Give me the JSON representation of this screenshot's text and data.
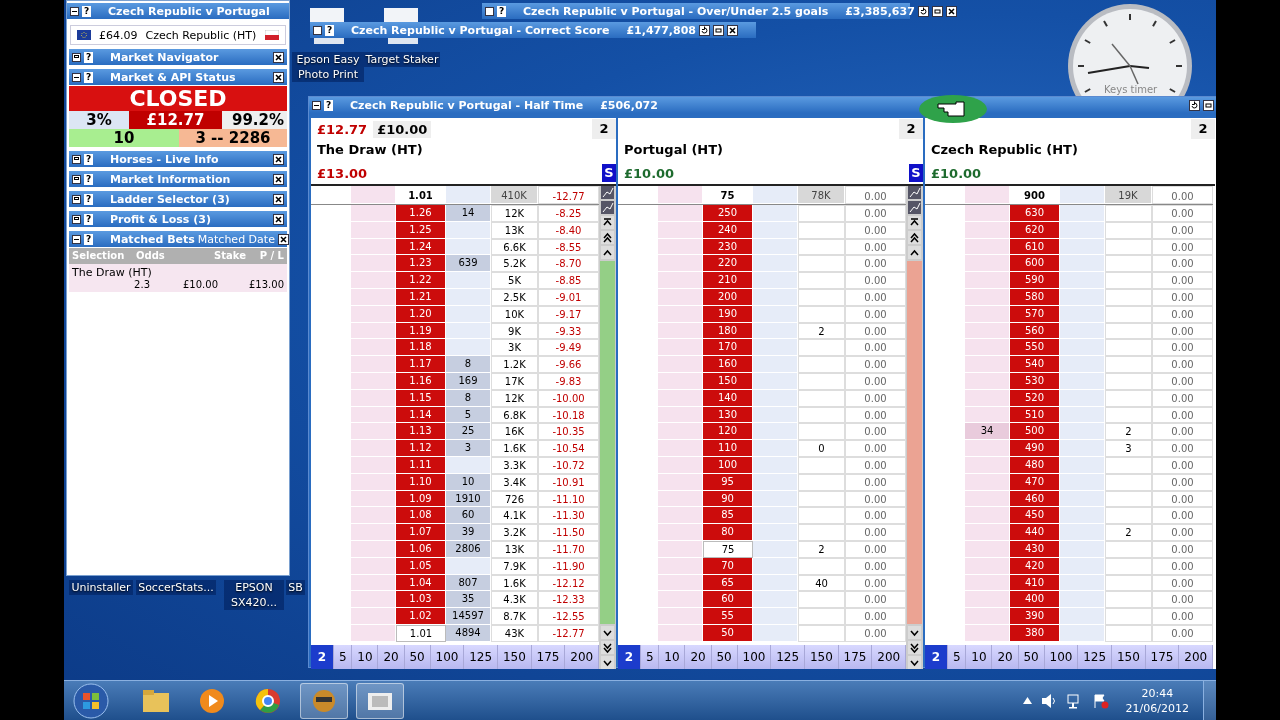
{
  "desktop_icons": [
    {
      "label": "Epson Easy Photo Print"
    },
    {
      "label": "Target Staker"
    },
    {
      "label": "Uninstaller"
    },
    {
      "label": "SoccerStats..."
    },
    {
      "label": "EPSON SX420..."
    },
    {
      "label": "SB"
    }
  ],
  "clock_label": "Keys timer",
  "background_windows": [
    {
      "help": "?",
      "title": "Czech Republic v Portugal - Over/Under 2.5 goals",
      "amount": "£3,385,637"
    },
    {
      "help": "?",
      "title": "Czech Republic v Portugal - Correct Score",
      "amount": "£1,477,808"
    }
  ],
  "side_panel": {
    "help": "?",
    "title": "Czech Republic v Portugal",
    "balance": "£64.09",
    "selection": "Czech Republic (HT)",
    "sections": [
      {
        "help": "?",
        "title": "Market Navigator",
        "expanded": false
      },
      {
        "help": "?",
        "title": "Market & API Status",
        "expanded": true,
        "kind": "status",
        "status": "CLOSED",
        "left_pct": "3%",
        "exposure": "£12.77",
        "right_pct": "99.2%",
        "left_count": "10",
        "right_count": "3 -- 2286"
      },
      {
        "help": "?",
        "title": "Horses - Live Info",
        "expanded": false
      },
      {
        "help": "?",
        "title": "Market Information",
        "expanded": false
      },
      {
        "help": "?",
        "title": "Ladder Selector (3)",
        "expanded": false
      },
      {
        "help": "?",
        "title": "Profit & Loss (3)",
        "expanded": false
      },
      {
        "help": "?",
        "title": "Matched Bets",
        "subtitle": "Matched Date",
        "expanded": true,
        "kind": "table",
        "columns": [
          "Selection",
          "Odds",
          "Stake",
          "P / L"
        ],
        "rows": [
          {
            "selection": "The Draw (HT)",
            "odds": "2.3",
            "stake": "£10.00",
            "pl": "£13.00"
          }
        ]
      }
    ]
  },
  "main_window": {
    "help": "?",
    "title": "Czech Republic v Portugal - Half Time",
    "amount": "£506,072",
    "ladders": [
      {
        "exposure": "£12.77",
        "stake": "£10.00",
        "tick": "2",
        "name": "The Draw (HT)",
        "pl": "£13.00",
        "color": "#c00000",
        "s_button": "S",
        "kind": "back",
        "grid_loss": true,
        "top": {
          "odds": "1.01",
          "vol": "410K",
          "pl": "-12.77"
        },
        "rows": [
          {
            "odds": "1.26",
            "lay": "14",
            "vol": "12K",
            "pl": "-8.25",
            "ltp": false
          },
          {
            "odds": "1.25",
            "vol": "13K",
            "pl": "-8.40",
            "ltp": false
          },
          {
            "odds": "1.24",
            "vol": "6.6K",
            "pl": "-8.55",
            "ltp": false
          },
          {
            "odds": "1.23",
            "lay": "639",
            "vol": "5.2K",
            "pl": "-8.70",
            "ltp": false
          },
          {
            "odds": "1.22",
            "vol": "5K",
            "pl": "-8.85",
            "ltp": false
          },
          {
            "odds": "1.21",
            "vol": "2.5K",
            "pl": "-9.01",
            "ltp": false
          },
          {
            "odds": "1.20",
            "vol": "10K",
            "pl": "-9.17",
            "ltp": false
          },
          {
            "odds": "1.19",
            "vol": "9K",
            "pl": "-9.33",
            "ltp": false
          },
          {
            "odds": "1.18",
            "vol": "3K",
            "pl": "-9.49",
            "ltp": false
          },
          {
            "odds": "1.17",
            "lay": "8",
            "vol": "1.2K",
            "pl": "-9.66",
            "ltp": false
          },
          {
            "odds": "1.16",
            "lay": "169",
            "vol": "17K",
            "pl": "-9.83",
            "ltp": false
          },
          {
            "odds": "1.15",
            "lay": "8",
            "vol": "12K",
            "pl": "-10.00",
            "ltp": false
          },
          {
            "odds": "1.14",
            "lay": "5",
            "vol": "6.8K",
            "pl": "-10.18",
            "ltp": false
          },
          {
            "odds": "1.13",
            "lay": "25",
            "vol": "16K",
            "pl": "-10.35",
            "ltp": false
          },
          {
            "odds": "1.12",
            "lay": "3",
            "vol": "1.6K",
            "pl": "-10.54",
            "ltp": false
          },
          {
            "odds": "1.11",
            "vol": "3.3K",
            "pl": "-10.72",
            "ltp": false
          },
          {
            "odds": "1.10",
            "lay": "10",
            "vol": "3.4K",
            "pl": "-10.91",
            "ltp": false
          },
          {
            "odds": "1.09",
            "lay": "1910",
            "vol": "726",
            "pl": "-11.10",
            "ltp": false
          },
          {
            "odds": "1.08",
            "lay": "60",
            "vol": "4.1K",
            "pl": "-11.30",
            "ltp": false
          },
          {
            "odds": "1.07",
            "lay": "39",
            "vol": "3.2K",
            "pl": "-11.50",
            "ltp": false
          },
          {
            "odds": "1.06",
            "lay": "2806",
            "vol": "13K",
            "pl": "-11.70",
            "ltp": false
          },
          {
            "odds": "1.05",
            "vol": "7.9K",
            "pl": "-11.90",
            "ltp": false
          },
          {
            "odds": "1.04",
            "lay": "807",
            "vol": "1.6K",
            "pl": "-12.12",
            "ltp": false
          },
          {
            "odds": "1.03",
            "lay": "35",
            "vol": "4.3K",
            "pl": "-12.33",
            "ltp": false
          },
          {
            "odds": "1.02",
            "lay": "14597",
            "vol": "8.7K",
            "pl": "-12.55",
            "ltp": false
          },
          {
            "odds": "1.01",
            "lay": "4894",
            "vol": "43K",
            "pl": "-12.77",
            "ltp": true
          }
        ],
        "stakes": [
          {
            "label": "2",
            "selected": true
          },
          {
            "label": "5",
            "selected": false
          },
          {
            "label": "10",
            "selected": false
          },
          {
            "label": "20",
            "selected": false
          },
          {
            "label": "50",
            "selected": false
          },
          {
            "label": "100",
            "selected": false
          },
          {
            "label": "125",
            "selected": false
          },
          {
            "label": "150",
            "selected": false
          },
          {
            "label": "175",
            "selected": false
          },
          {
            "label": "200",
            "selected": false
          }
        ]
      },
      {
        "tick": "2",
        "name": "Portugal (HT)",
        "pl": "£10.00",
        "color": "#1e6b2e",
        "s_button": "S",
        "kind": "lay",
        "grid_loss": false,
        "top": {
          "odds": "75",
          "vol": "78K",
          "pl": "0.00"
        },
        "rows": [
          {
            "odds": "250",
            "pl": "0.00",
            "ltp": false
          },
          {
            "odds": "240",
            "pl": "0.00",
            "ltp": false
          },
          {
            "odds": "230",
            "pl": "0.00",
            "ltp": false
          },
          {
            "odds": "220",
            "pl": "0.00",
            "ltp": false
          },
          {
            "odds": "210",
            "pl": "0.00",
            "ltp": false
          },
          {
            "odds": "200",
            "pl": "0.00",
            "ltp": false
          },
          {
            "odds": "190",
            "pl": "0.00",
            "ltp": false
          },
          {
            "odds": "180",
            "vol": "2",
            "pl": "0.00",
            "ltp": false
          },
          {
            "odds": "170",
            "pl": "0.00",
            "ltp": false
          },
          {
            "odds": "160",
            "pl": "0.00",
            "ltp": false
          },
          {
            "odds": "150",
            "pl": "0.00",
            "ltp": false
          },
          {
            "odds": "140",
            "pl": "0.00",
            "ltp": false
          },
          {
            "odds": "130",
            "pl": "0.00",
            "ltp": false
          },
          {
            "odds": "120",
            "pl": "0.00",
            "ltp": false
          },
          {
            "odds": "110",
            "vol": "0",
            "pl": "0.00",
            "ltp": false
          },
          {
            "odds": "100",
            "pl": "0.00",
            "ltp": false
          },
          {
            "odds": "95",
            "pl": "0.00",
            "ltp": false
          },
          {
            "odds": "90",
            "pl": "0.00",
            "ltp": false
          },
          {
            "odds": "85",
            "pl": "0.00",
            "ltp": false
          },
          {
            "odds": "80",
            "pl": "0.00",
            "ltp": false
          },
          {
            "odds": "75",
            "vol": "2",
            "pl": "0.00",
            "ltp": true
          },
          {
            "odds": "70",
            "pl": "0.00",
            "ltp": false
          },
          {
            "odds": "65",
            "vol": "40",
            "pl": "0.00",
            "ltp": false
          },
          {
            "odds": "60",
            "pl": "0.00",
            "ltp": false
          },
          {
            "odds": "55",
            "pl": "0.00",
            "ltp": false
          },
          {
            "odds": "50",
            "pl": "0.00",
            "ltp": false
          }
        ],
        "stakes": [
          {
            "label": "2",
            "selected": true
          },
          {
            "label": "5",
            "selected": false
          },
          {
            "label": "10",
            "selected": false
          },
          {
            "label": "20",
            "selected": false
          },
          {
            "label": "50",
            "selected": false
          },
          {
            "label": "100",
            "selected": false
          },
          {
            "label": "125",
            "selected": false
          },
          {
            "label": "150",
            "selected": false
          },
          {
            "label": "175",
            "selected": false
          },
          {
            "label": "200",
            "selected": false
          }
        ]
      },
      {
        "tick": "2",
        "name": "Czech Republic (HT)",
        "pl": "£10.00",
        "color": "#1e6b2e",
        "kind": "plain",
        "grid_loss": false,
        "top": {
          "odds": "900",
          "vol": "19K",
          "pl": "0.00"
        },
        "rows": [
          {
            "odds": "630",
            "pl": "0.00",
            "ltp": false
          },
          {
            "odds": "620",
            "pl": "0.00",
            "ltp": false
          },
          {
            "odds": "610",
            "pl": "0.00",
            "ltp": false
          },
          {
            "odds": "600",
            "pl": "0.00",
            "ltp": false
          },
          {
            "odds": "590",
            "pl": "0.00",
            "ltp": false
          },
          {
            "odds": "580",
            "pl": "0.00",
            "ltp": false
          },
          {
            "odds": "570",
            "pl": "0.00",
            "ltp": false
          },
          {
            "odds": "560",
            "pl": "0.00",
            "ltp": false
          },
          {
            "odds": "550",
            "pl": "0.00",
            "ltp": false
          },
          {
            "odds": "540",
            "pl": "0.00",
            "ltp": false
          },
          {
            "odds": "530",
            "pl": "0.00",
            "ltp": false
          },
          {
            "odds": "520",
            "pl": "0.00",
            "ltp": false
          },
          {
            "odds": "510",
            "pl": "0.00",
            "ltp": false
          },
          {
            "odds": "500",
            "back": "34",
            "vol": "2",
            "pl": "0.00",
            "ltp": false
          },
          {
            "odds": "490",
            "vol": "3",
            "pl": "0.00",
            "ltp": false
          },
          {
            "odds": "480",
            "pl": "0.00",
            "ltp": false
          },
          {
            "odds": "470",
            "pl": "0.00",
            "ltp": false
          },
          {
            "odds": "460",
            "pl": "0.00",
            "ltp": false
          },
          {
            "odds": "450",
            "pl": "0.00",
            "ltp": false
          },
          {
            "odds": "440",
            "vol": "2",
            "pl": "0.00",
            "ltp": false
          },
          {
            "odds": "430",
            "pl": "0.00",
            "ltp": false
          },
          {
            "odds": "420",
            "pl": "0.00",
            "ltp": false
          },
          {
            "odds": "410",
            "pl": "0.00",
            "ltp": false
          },
          {
            "odds": "400",
            "pl": "0.00",
            "ltp": false
          },
          {
            "odds": "390",
            "pl": "0.00",
            "ltp": false
          },
          {
            "odds": "380",
            "pl": "0.00",
            "ltp": false
          }
        ],
        "stakes": [
          {
            "label": "2",
            "selected": true
          },
          {
            "label": "5",
            "selected": false
          },
          {
            "label": "10",
            "selected": false
          },
          {
            "label": "20",
            "selected": false
          },
          {
            "label": "50",
            "selected": false
          },
          {
            "label": "100",
            "selected": false
          },
          {
            "label": "125",
            "selected": false
          },
          {
            "label": "150",
            "selected": false
          },
          {
            "label": "175",
            "selected": false
          },
          {
            "label": "200",
            "selected": false
          }
        ]
      }
    ]
  },
  "taskbar": {
    "time": "20:44",
    "date": "21/06/2012"
  }
}
